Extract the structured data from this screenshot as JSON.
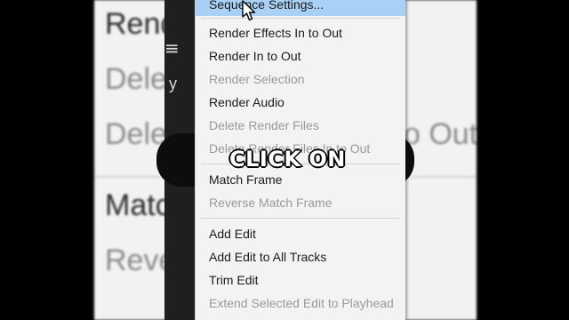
{
  "menu": {
    "items": [
      {
        "label": "Sequence Settings...",
        "enabled": true,
        "highlighted": true
      },
      {
        "label": "Render Effects In to Out",
        "enabled": true
      },
      {
        "label": "Render In to Out",
        "enabled": true
      },
      {
        "label": "Render Selection",
        "enabled": false
      },
      {
        "label": "Render Audio",
        "enabled": true
      },
      {
        "label": "Delete Render Files",
        "enabled": false
      },
      {
        "label": "Delete Render Files In to Out",
        "enabled": false
      },
      {
        "label": "Match Frame",
        "enabled": true
      },
      {
        "label": "Reverse Match Frame",
        "enabled": false
      },
      {
        "label": "Add Edit",
        "enabled": true
      },
      {
        "label": "Add Edit to All Tracks",
        "enabled": true
      },
      {
        "label": "Trim Edit",
        "enabled": true
      },
      {
        "label": "Extend Selected Edit to Playhead",
        "enabled": false
      }
    ]
  },
  "background": {
    "render": "Rend",
    "delete1": "Dele",
    "delete2": "Dele",
    "out": "o Out",
    "match": "Matc",
    "reverse": "Reve"
  },
  "caption": "CLICK ON",
  "colors": {
    "highlight": "#a9d0f5",
    "menu_bg": "#f3f3f3",
    "disabled_text": "#9a9a9a"
  }
}
